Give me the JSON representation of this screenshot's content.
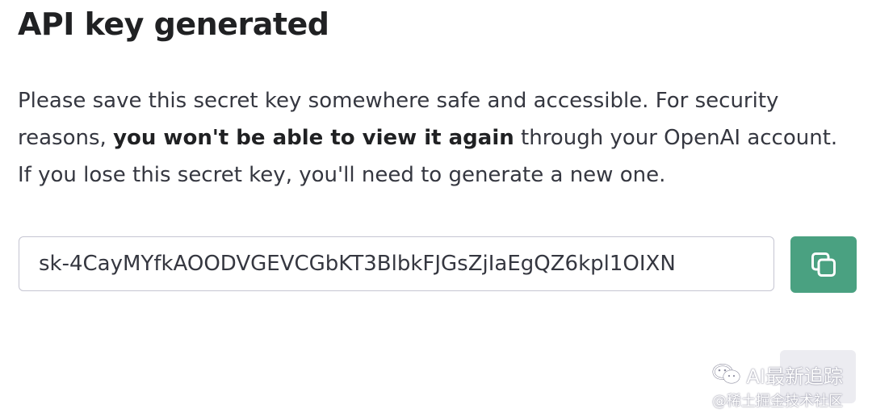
{
  "dialog": {
    "title": "API key generated",
    "description": {
      "part1": "Please save this secret key somewhere safe and accessible. For security reasons, ",
      "bold": "you won't be able to view it again",
      "part2": " through your OpenAI account. If you lose this secret key, you'll need to generate a new one."
    },
    "key_value": "sk-4CayMYfkAOODVGEVCGbKT3BlbkFJGsZjIaEgQZ6kpl1OIXN",
    "copy_icon": "copy-icon"
  },
  "watermark": {
    "line1": "AI最新追踪",
    "line2": "@稀土掘金技术社区",
    "icon": "wechat-icon"
  },
  "colors": {
    "accent": "#4aa181",
    "border": "#c5c5d2",
    "text": "#353740",
    "title": "#202123"
  }
}
